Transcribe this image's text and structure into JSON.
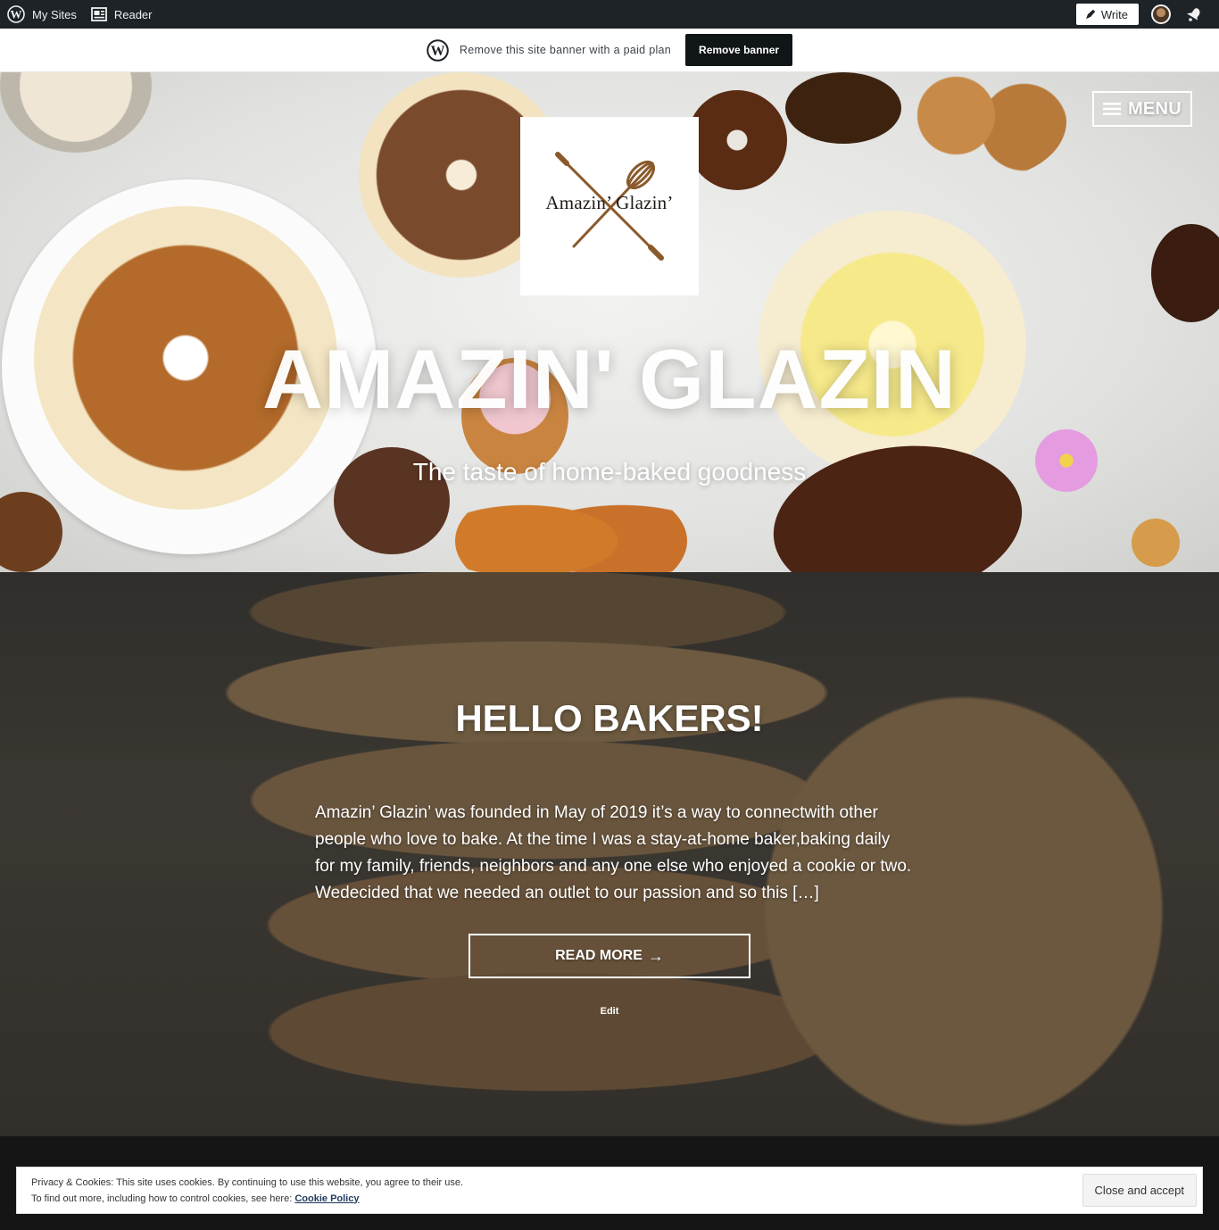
{
  "adminbar": {
    "my_sites": "My Sites",
    "reader": "Reader",
    "write": "Write"
  },
  "site_banner": {
    "text": "Remove this site banner with a paid plan",
    "button": "Remove banner"
  },
  "hero": {
    "logo_text": "Amazin’ Glazin’",
    "menu_label": "MENU",
    "site_title": "AMAZIN' GLAZIN",
    "tagline": "The taste of home-baked goodness"
  },
  "post": {
    "title": "HELLO BAKERS!",
    "excerpt": "Amazin’ Glazin’ was founded in May of 2019 it’s a way to connectwith other people who love to bake. At the time I was a stay-at-home baker,baking daily for my family, friends, neighbors and any one else who enjoyed a cookie or two. Wedecided that we needed an outlet to our passion and so this […]",
    "read_more": "READ MORE",
    "read_more_arrow": "→",
    "edit": "Edit"
  },
  "cookie_notice": {
    "line1": "Privacy & Cookies: This site uses cookies. By continuing to use this website, you agree to their use.",
    "line2": "To find out more, including how to control cookies, see here:",
    "link": "Cookie Policy",
    "button": "Close and accept"
  },
  "colors": {
    "adminbar_bg": "#1d2327",
    "banner_button_bg": "#101517",
    "footer_bg": "#151515"
  },
  "icons": {
    "wordpress": "wordpress-icon",
    "reader": "reader-icon",
    "write": "pen-icon",
    "avatar": "avatar",
    "notifications": "bell-icon",
    "menu": "hamburger-icon"
  }
}
